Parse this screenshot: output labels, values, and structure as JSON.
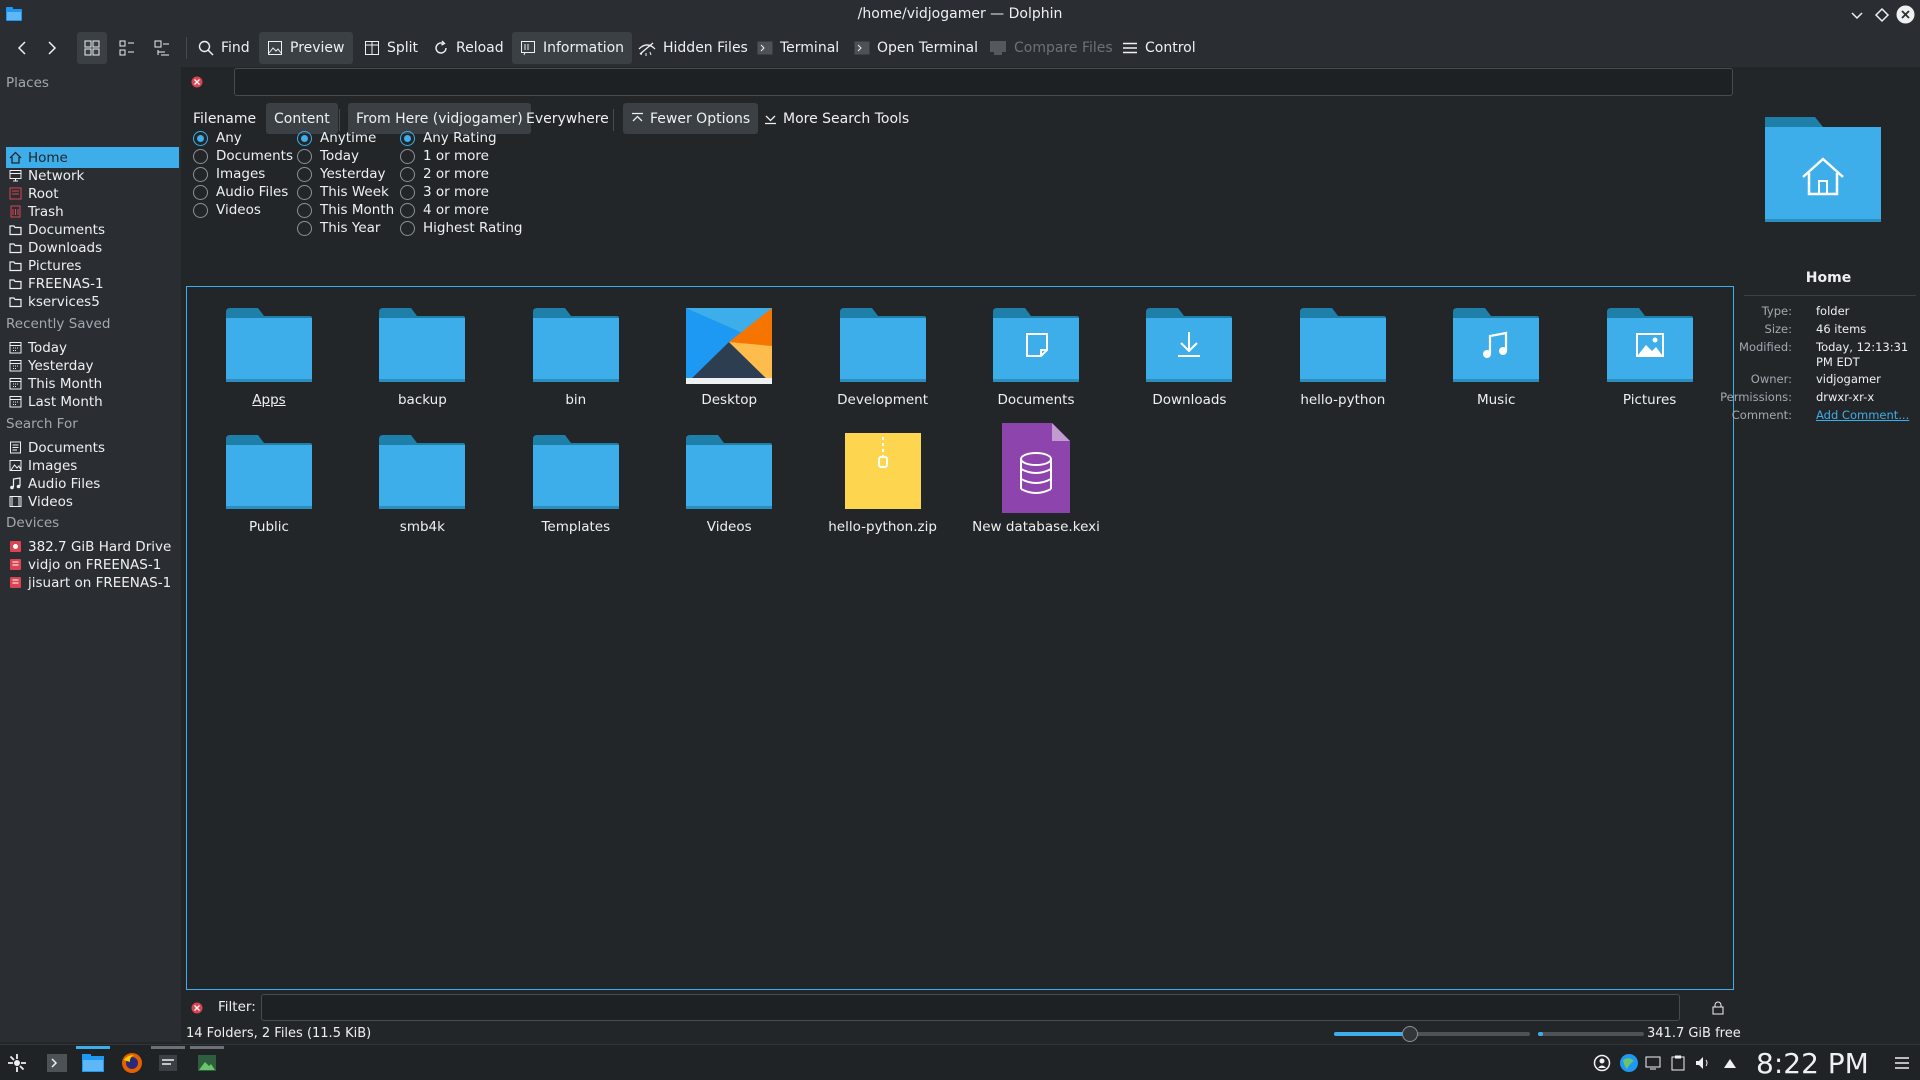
{
  "window": {
    "title": "/home/vidjogamer — Dolphin"
  },
  "toolbar": {
    "find": "Find",
    "preview": "Preview",
    "split": "Split",
    "reload": "Reload",
    "information": "Information",
    "hidden_files": "Hidden Files",
    "terminal": "Terminal",
    "open_terminal": "Open Terminal",
    "compare_files": "Compare Files",
    "control": "Control"
  },
  "places": {
    "sections": {
      "places": "Places",
      "recently_saved": "Recently Saved",
      "search_for": "Search For",
      "devices": "Devices"
    },
    "places_items": [
      {
        "label": "Home",
        "icon": "home-icon"
      },
      {
        "label": "Network",
        "icon": "network-icon"
      },
      {
        "label": "Root",
        "icon": "drive-icon"
      },
      {
        "label": "Trash",
        "icon": "trash-icon"
      },
      {
        "label": "Documents",
        "icon": "folder-icon"
      },
      {
        "label": "Downloads",
        "icon": "folder-icon"
      },
      {
        "label": "Pictures",
        "icon": "folder-icon"
      },
      {
        "label": "FREENAS-1",
        "icon": "folder-icon"
      },
      {
        "label": "kservices5",
        "icon": "folder-icon"
      }
    ],
    "recent_items": [
      {
        "label": "Today",
        "icon": "calendar-icon"
      },
      {
        "label": "Yesterday",
        "icon": "calendar-icon"
      },
      {
        "label": "This Month",
        "icon": "calendar-icon"
      },
      {
        "label": "Last Month",
        "icon": "calendar-icon"
      }
    ],
    "search_items": [
      {
        "label": "Documents",
        "icon": "document-icon"
      },
      {
        "label": "Images",
        "icon": "image-icon"
      },
      {
        "label": "Audio Files",
        "icon": "music-icon"
      },
      {
        "label": "Videos",
        "icon": "video-icon"
      }
    ],
    "device_items": [
      {
        "label": "382.7 GiB Hard Drive",
        "icon": "harddrive-icon"
      },
      {
        "label": "vidjo on FREENAS-1",
        "icon": "network-drive-icon"
      },
      {
        "label": "jisuart on FREENAS-1",
        "icon": "network-drive-icon"
      }
    ]
  },
  "search": {
    "query": "",
    "filename": "Filename",
    "content": "Content",
    "from_here": "From Here (vidjogamer)",
    "everywhere": "Everywhere",
    "fewer_options": "Fewer Options",
    "more_tools": "More Search Tools",
    "type_options": [
      "Any",
      "Documents",
      "Images",
      "Audio Files",
      "Videos"
    ],
    "date_options": [
      "Anytime",
      "Today",
      "Yesterday",
      "This Week",
      "This Month",
      "This Year"
    ],
    "rating_options": [
      "Any Rating",
      "1 or more",
      "2 or more",
      "3 or more",
      "4 or more",
      "Highest Rating"
    ],
    "selected": {
      "type": "Any",
      "date": "Anytime",
      "rating": "Any Rating"
    }
  },
  "files": [
    {
      "name": "Apps",
      "kind": "folder"
    },
    {
      "name": "backup",
      "kind": "folder"
    },
    {
      "name": "bin",
      "kind": "folder"
    },
    {
      "name": "Desktop",
      "kind": "desktop"
    },
    {
      "name": "Development",
      "kind": "folder"
    },
    {
      "name": "Documents",
      "kind": "folder-documents"
    },
    {
      "name": "Downloads",
      "kind": "folder-downloads"
    },
    {
      "name": "hello-python",
      "kind": "folder"
    },
    {
      "name": "Music",
      "kind": "folder-music"
    },
    {
      "name": "Pictures",
      "kind": "folder-pictures"
    },
    {
      "name": "Public",
      "kind": "folder"
    },
    {
      "name": "smb4k",
      "kind": "folder"
    },
    {
      "name": "Templates",
      "kind": "folder"
    },
    {
      "name": "Videos",
      "kind": "folder"
    },
    {
      "name": "hello-python.zip",
      "kind": "zip"
    },
    {
      "name": "New database.kexi",
      "kind": "database"
    }
  ],
  "info": {
    "name": "Home",
    "type_k": "Type:",
    "type": "folder",
    "size_k": "Size:",
    "size": "46 items",
    "modified_k": "Modified:",
    "modified_1": "Today, 12:13:31",
    "modified_2": "PM EDT",
    "owner_k": "Owner:",
    "owner": "vidjogamer",
    "perm_k": "Permissions:",
    "permissions": "drwxr-xr-x",
    "comment_k": "Comment:",
    "comment": "Add Comment..."
  },
  "filter": {
    "label": "Filter:",
    "value": ""
  },
  "status": {
    "summary": "14 Folders, 2 Files (11.5 KiB)",
    "free": "341.7 GiB free",
    "zoom_fraction": 0.39,
    "used_fraction": 0.05
  },
  "clock": "8:22 PM",
  "colors": {
    "accent": "#3daee9",
    "folder": "#3daee9",
    "window_bg": "#232629",
    "panel_bg": "#2a2e32"
  }
}
